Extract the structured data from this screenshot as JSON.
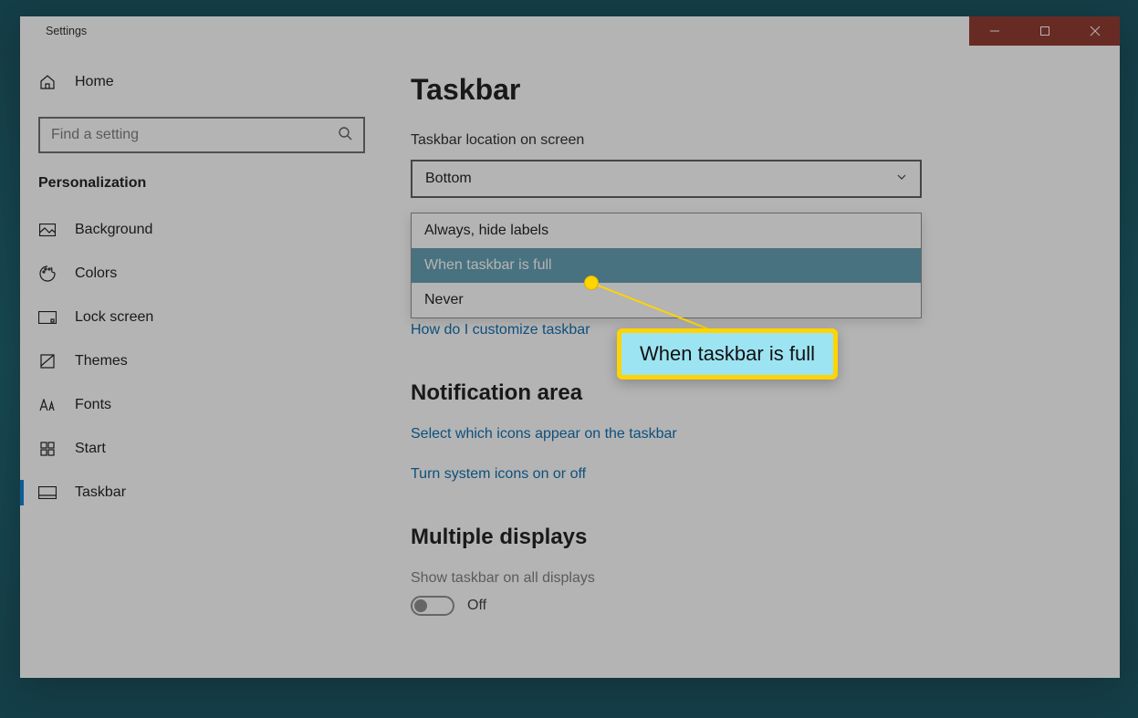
{
  "window": {
    "title": "Settings"
  },
  "sidebar": {
    "home_label": "Home",
    "search_placeholder": "Find a setting",
    "category": "Personalization",
    "items": [
      {
        "label": "Background",
        "icon": "picture-icon"
      },
      {
        "label": "Colors",
        "icon": "palette-icon"
      },
      {
        "label": "Lock screen",
        "icon": "lockscreen-icon"
      },
      {
        "label": "Themes",
        "icon": "themes-icon"
      },
      {
        "label": "Fonts",
        "icon": "fonts-icon"
      },
      {
        "label": "Start",
        "icon": "start-icon"
      },
      {
        "label": "Taskbar",
        "icon": "taskbar-icon",
        "active": true
      }
    ]
  },
  "main": {
    "page_title": "Taskbar",
    "location_label": "Taskbar location on screen",
    "location_value": "Bottom",
    "combine_options": [
      "Always, hide labels",
      "When taskbar is full",
      "Never"
    ],
    "combine_selected_index": 1,
    "partial_link": "How do I customize taskbar",
    "notification_heading": "Notification area",
    "notification_links": [
      "Select which icons appear on the taskbar",
      "Turn system icons on or off"
    ],
    "multiple_heading": "Multiple displays",
    "multiple_toggle_label": "Show taskbar on all displays",
    "multiple_toggle_state": "Off"
  },
  "callout": {
    "text": "When taskbar is full"
  }
}
